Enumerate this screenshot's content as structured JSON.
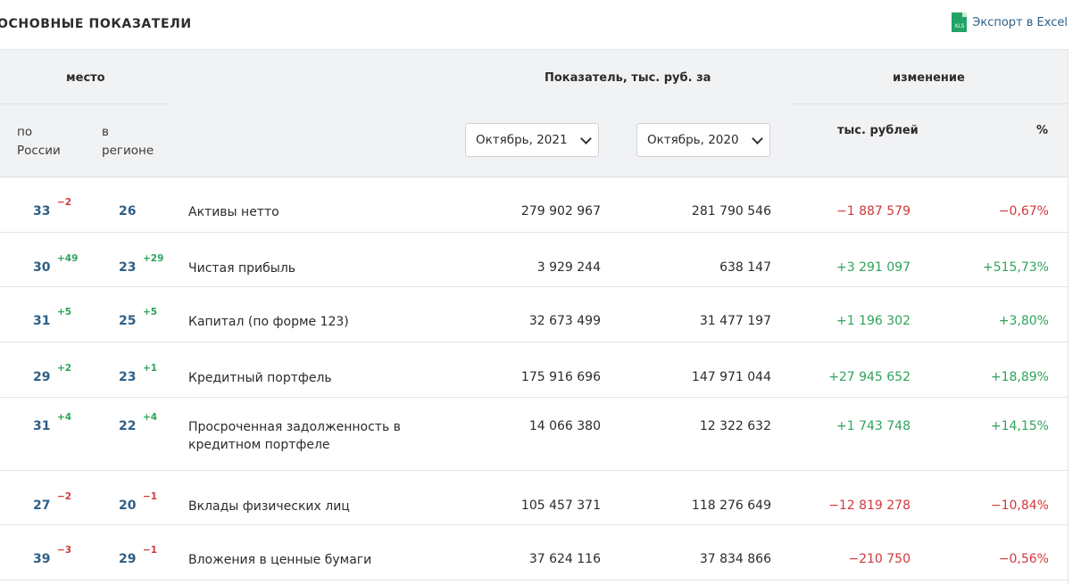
{
  "header": {
    "title": "ОСНОВНЫЕ ПОКАЗАТЕЛИ",
    "export_label": "Экспорт в Excel",
    "export_icon": "xls-file-icon",
    "export_icon_text": "XLS"
  },
  "columns": {
    "mesto": "место",
    "russia": "по России",
    "region": "в регионе",
    "pokazatel": "Показатель, тыс. руб. за",
    "change": "изменение",
    "change_rub": "тыс. рублей",
    "change_pct": "%",
    "period1": "Октябрь, 2021",
    "period2": "Октябрь, 2020"
  },
  "colors": {
    "positive": "#2fa35a",
    "negative": "#d0393c",
    "rank": "#2e5f87",
    "header_bg": "#f1f2f4"
  },
  "rows": [
    {
      "rank_ru": "33",
      "delta_ru": "−2",
      "rank_reg": "26",
      "delta_reg": "",
      "name": "Активы нетто",
      "v1": "279 902 967",
      "v2": "281 790 546",
      "ch": "−1 887 579",
      "pct": "−0,67%"
    },
    {
      "rank_ru": "30",
      "delta_ru": "+49",
      "rank_reg": "23",
      "delta_reg": "+29",
      "name": "Чистая прибыль",
      "v1": "3 929 244",
      "v2": "638 147",
      "ch": "+3 291 097",
      "pct": "+515,73%"
    },
    {
      "rank_ru": "31",
      "delta_ru": "+5",
      "rank_reg": "25",
      "delta_reg": "+5",
      "name": "Капитал (по форме 123)",
      "v1": "32 673 499",
      "v2": "31 477 197",
      "ch": "+1 196 302",
      "pct": "+3,80%"
    },
    {
      "rank_ru": "29",
      "delta_ru": "+2",
      "rank_reg": "23",
      "delta_reg": "+1",
      "name": "Кредитный портфель",
      "v1": "175 916 696",
      "v2": "147 971 044",
      "ch": "+27 945 652",
      "pct": "+18,89%"
    },
    {
      "rank_ru": "31",
      "delta_ru": "+4",
      "rank_reg": "22",
      "delta_reg": "+4",
      "name": "Просроченная задолженность в кредитном портфеле",
      "v1": "14 066 380",
      "v2": "12 322 632",
      "ch": "+1 743 748",
      "pct": "+14,15%"
    },
    {
      "rank_ru": "27",
      "delta_ru": "−2",
      "rank_reg": "20",
      "delta_reg": "−1",
      "name": "Вклады физических лиц",
      "v1": "105 457 371",
      "v2": "118 276 649",
      "ch": "−12 819 278",
      "pct": "−10,84%"
    },
    {
      "rank_ru": "39",
      "delta_ru": "−3",
      "rank_reg": "29",
      "delta_reg": "−1",
      "name": "Вложения в ценные бумаги",
      "v1": "37 624 116",
      "v2": "37 834 866",
      "ch": "−210 750",
      "pct": "−0,56%"
    }
  ]
}
